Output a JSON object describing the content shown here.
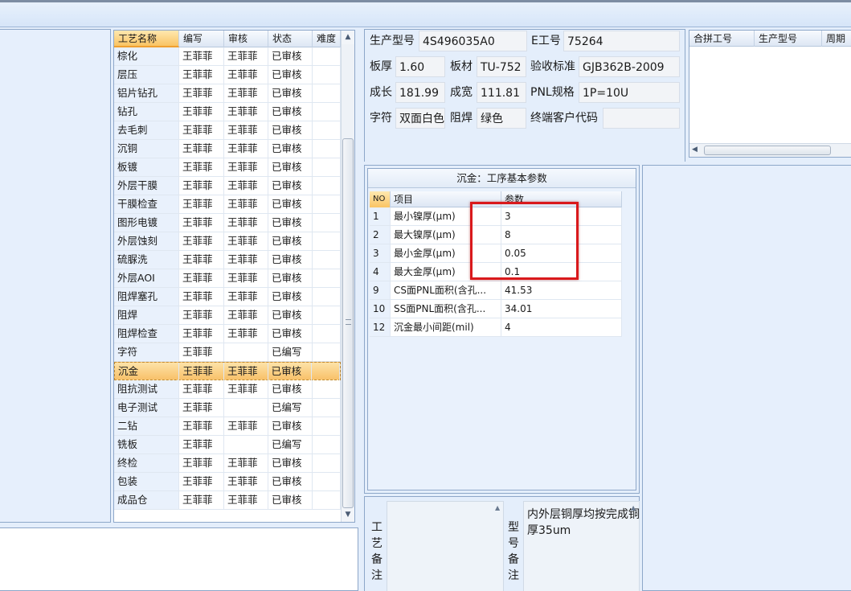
{
  "process_list": {
    "columns": [
      "工艺名称",
      "编写",
      "审核",
      "状态",
      "难度"
    ],
    "rows": [
      [
        "棕化",
        "王菲菲",
        "王菲菲",
        "已审核",
        ""
      ],
      [
        "层压",
        "王菲菲",
        "王菲菲",
        "已审核",
        ""
      ],
      [
        "铝片钻孔",
        "王菲菲",
        "王菲菲",
        "已审核",
        ""
      ],
      [
        "钻孔",
        "王菲菲",
        "王菲菲",
        "已审核",
        ""
      ],
      [
        "去毛刺",
        "王菲菲",
        "王菲菲",
        "已审核",
        ""
      ],
      [
        "沉铜",
        "王菲菲",
        "王菲菲",
        "已审核",
        ""
      ],
      [
        "板镀",
        "王菲菲",
        "王菲菲",
        "已审核",
        ""
      ],
      [
        "外层干膜",
        "王菲菲",
        "王菲菲",
        "已审核",
        ""
      ],
      [
        "干膜检查",
        "王菲菲",
        "王菲菲",
        "已审核",
        ""
      ],
      [
        "图形电镀",
        "王菲菲",
        "王菲菲",
        "已审核",
        ""
      ],
      [
        "外层蚀刻",
        "王菲菲",
        "王菲菲",
        "已审核",
        ""
      ],
      [
        "硫脲洗",
        "王菲菲",
        "王菲菲",
        "已审核",
        ""
      ],
      [
        "外层AOI",
        "王菲菲",
        "王菲菲",
        "已审核",
        ""
      ],
      [
        "阻焊塞孔",
        "王菲菲",
        "王菲菲",
        "已审核",
        ""
      ],
      [
        "阻焊",
        "王菲菲",
        "王菲菲",
        "已审核",
        ""
      ],
      [
        "阻焊检查",
        "王菲菲",
        "王菲菲",
        "已审核",
        ""
      ],
      [
        "字符",
        "王菲菲",
        "",
        "已编写",
        ""
      ],
      [
        "沉金",
        "王菲菲",
        "王菲菲",
        "已审核",
        ""
      ],
      [
        "阻抗测试",
        "王菲菲",
        "王菲菲",
        "已审核",
        ""
      ],
      [
        "电子测试",
        "王菲菲",
        "",
        "已编写",
        ""
      ],
      [
        "二钻",
        "王菲菲",
        "王菲菲",
        "已审核",
        ""
      ],
      [
        "铣板",
        "王菲菲",
        "",
        "已编写",
        ""
      ],
      [
        "终检",
        "王菲菲",
        "王菲菲",
        "已审核",
        ""
      ],
      [
        "包装",
        "王菲菲",
        "王菲菲",
        "已审核",
        ""
      ],
      [
        "成品仓",
        "王菲菲",
        "王菲菲",
        "已审核",
        ""
      ]
    ],
    "selected_index": 17
  },
  "info": {
    "production_model_label": "生产型号",
    "production_model": "4S496035A0",
    "e_no_label": "E工号",
    "e_no": "75264",
    "thickness_label": "板厚",
    "thickness": "1.60",
    "material_label": "板材",
    "material": "TU-752",
    "standard_label": "验收标准",
    "standard": "GJB362B-2009",
    "length_label": "成长",
    "length": "181.99",
    "width_label": "成宽",
    "width": "111.81",
    "pnl_label": "PNL规格",
    "pnl": "1P=10U",
    "silkscreen_label": "字符",
    "silkscreen": "双面白色",
    "soldermask_label": "阻焊",
    "soldermask": "绿色",
    "end_customer_label": "终端客户代码",
    "end_customer": ""
  },
  "combine": {
    "columns": [
      "合拼工号",
      "生产型号",
      "周期"
    ]
  },
  "params": {
    "title": "沉金：工序基本参数",
    "columns": [
      "NO",
      "项目",
      "参数"
    ],
    "rows": [
      [
        "1",
        "最小镍厚(μm)",
        "3"
      ],
      [
        "2",
        "最大镍厚(μm)",
        "8"
      ],
      [
        "3",
        "最小金厚(μm)",
        "0.05"
      ],
      [
        "4",
        "最大金厚(μm)",
        "0.1"
      ],
      [
        "9",
        "CS面PNL面积(含孔...",
        "41.53"
      ],
      [
        "10",
        "SS面PNL面积(含孔...",
        "34.01"
      ],
      [
        "12",
        "沉金最小间距(mil)",
        "4"
      ]
    ]
  },
  "remarks": {
    "process_label": "工艺备注",
    "model_label": "型号备注",
    "process_text": "",
    "model_text": "内外层铜厚均按完成铜厚35um"
  },
  "colors": {
    "highlight": "#d9191c",
    "selection": "#f8c16a"
  }
}
